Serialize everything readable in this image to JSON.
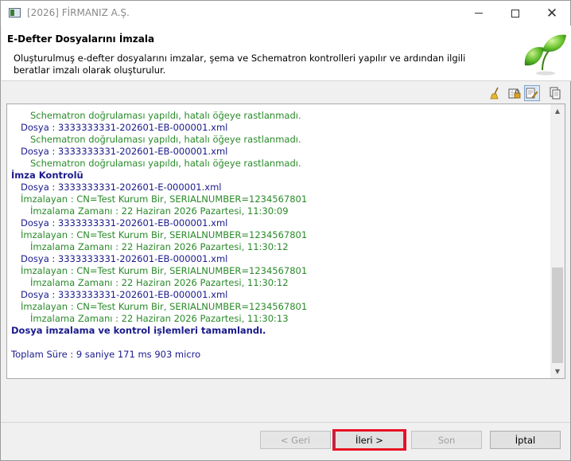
{
  "window": {
    "title": "[2026] FİRMANIZ A.Ş."
  },
  "header": {
    "title": "E-Defter Dosyalarını İmzala",
    "description": "Oluşturulmuş e-defter dosyalarını imzalar, şema ve Schematron kontrolleri yapılır ve ardından ilgili beratlar imzalı olarak oluşturulur."
  },
  "toolbar": {
    "icons": [
      "broom-icon",
      "lock-grid-icon",
      "sign-icon",
      "copy-icon"
    ]
  },
  "log": {
    "lines": [
      {
        "text": "Schematron doğrulaması yapıldı, hatalı öğeye rastlanmadı.",
        "style": "green",
        "indent": 2
      },
      {
        "text": "Dosya : 3333333331-202601-EB-000001.xml",
        "style": "navy",
        "indent": 1
      },
      {
        "text": "Schematron doğrulaması yapıldı, hatalı öğeye rastlanmadı.",
        "style": "green",
        "indent": 2
      },
      {
        "text": "Dosya : 3333333331-202601-EB-000001.xml",
        "style": "navy",
        "indent": 1
      },
      {
        "text": "Schematron doğrulaması yapıldı, hatalı öğeye rastlanmadı.",
        "style": "green",
        "indent": 2
      },
      {
        "text": "İmza Kontrolü",
        "style": "bold",
        "indent": 0
      },
      {
        "text": "Dosya : 3333333331-202601-E-000001.xml",
        "style": "navy",
        "indent": 1
      },
      {
        "text": "İmzalayan : CN=Test Kurum Bir, SERIALNUMBER=1234567801",
        "style": "green",
        "indent": 1
      },
      {
        "text": "İmzalama Zamanı : 22 Haziran 2026 Pazartesi, 11:30:09",
        "style": "green",
        "indent": 2
      },
      {
        "text": "Dosya : 3333333331-202601-EB-000001.xml",
        "style": "navy",
        "indent": 1
      },
      {
        "text": "İmzalayan : CN=Test Kurum Bir, SERIALNUMBER=1234567801",
        "style": "green",
        "indent": 1
      },
      {
        "text": "İmzalama Zamanı : 22 Haziran 2026 Pazartesi, 11:30:12",
        "style": "green",
        "indent": 2
      },
      {
        "text": "Dosya : 3333333331-202601-EB-000001.xml",
        "style": "navy",
        "indent": 1
      },
      {
        "text": "İmzalayan : CN=Test Kurum Bir, SERIALNUMBER=1234567801",
        "style": "green",
        "indent": 1
      },
      {
        "text": "İmzalama Zamanı : 22 Haziran 2026 Pazartesi, 11:30:12",
        "style": "green",
        "indent": 2
      },
      {
        "text": "Dosya : 3333333331-202601-EB-000001.xml",
        "style": "navy",
        "indent": 1
      },
      {
        "text": "İmzalayan : CN=Test Kurum Bir, SERIALNUMBER=1234567801",
        "style": "green",
        "indent": 1
      },
      {
        "text": "İmzalama Zamanı : 22 Haziran 2026 Pazartesi, 11:30:13",
        "style": "green",
        "indent": 2
      },
      {
        "text": "Dosya imzalama ve kontrol işlemleri tamamlandı.",
        "style": "bold",
        "indent": 0
      },
      {
        "text": "",
        "style": "navy",
        "indent": 0
      },
      {
        "text": "Toplam Süre : 9 saniye 171 ms 903 micro",
        "style": "navy",
        "indent": 0
      }
    ]
  },
  "buttons": {
    "back": "< Geri",
    "next": "İleri >",
    "finish": "Son",
    "cancel": "İptal"
  },
  "colors": {
    "highlight": "#e81123",
    "navy_text": "#1a1a8c",
    "green_text": "#2a8a2a"
  }
}
